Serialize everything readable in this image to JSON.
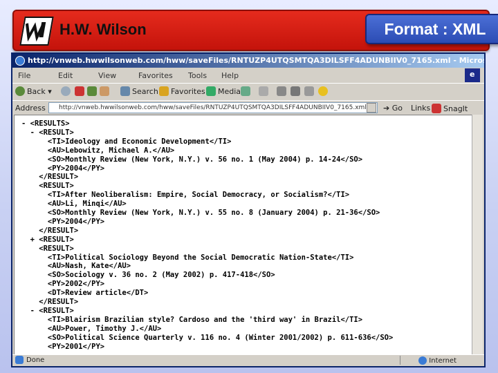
{
  "banner": {
    "brand": "H.W. Wilson",
    "format_label": "Format : XML"
  },
  "window": {
    "title": "http://vnweb.hwwilsonweb.com/hww/saveFiles/RNTUZP4UTQSMTQA3DILSFF4ADUNBIIV0_7165.xml - Microsoft Internet Explor...",
    "menu": [
      "File",
      "Edit",
      "View",
      "Favorites",
      "Tools",
      "Help"
    ],
    "toolbar": {
      "back": "Back",
      "search": "Search",
      "favorites": "Favorites",
      "media": "Media"
    },
    "address": {
      "label": "Address",
      "value": "http://vnweb.hwwilsonweb.com/hww/saveFiles/RNTUZP4UTQSMTQA3DILSFF4ADUNBIIV0_7165.xml",
      "go": "Go",
      "links": "Links",
      "snagit": "SnagIt"
    },
    "status": {
      "left": "Done",
      "zone": "Internet"
    }
  },
  "xml_lines": [
    "- <RESULTS>",
    "  - <RESULT>",
    "      <TI>Ideology and Economic Development</TI>",
    "      <AU>Lebowitz, Michael A.</AU>",
    "      <SO>Monthly Review (New York, N.Y.) v. 56 no. 1 (May 2004) p. 14-24</SO>",
    "      <PY>2004</PY>",
    "    </RESULT>",
    "    <RESULT>",
    "      <TI>After Neoliberalism: Empire, Social Democracy, or Socialism?</TI>",
    "      <AU>Li, Minqi</AU>",
    "      <SO>Monthly Review (New York, N.Y.) v. 55 no. 8 (January 2004) p. 21-36</SO>",
    "      <PY>2004</PY>",
    "    </RESULT>",
    "  + <RESULT>",
    "    <RESULT>",
    "      <TI>Political Sociology Beyond the Social Democratic Nation-State</TI>",
    "      <AU>Nash, Kate</AU>",
    "      <SO>Sociology v. 36 no. 2 (May 2002) p. 417-418</SO>",
    "      <PY>2002</PY>",
    "      <DT>Review article</DT>",
    "    </RESULT>",
    "  - <RESULT>",
    "      <TI>Blairism Brazilian style? Cardoso and the 'third way' in Brazil</TI>",
    "      <AU>Power, Timothy J.</AU>",
    "      <SO>Political Science Quarterly v. 116 no. 4 (Winter 2001/2002) p. 611-636</SO>",
    "      <PY>2001</PY>"
  ]
}
